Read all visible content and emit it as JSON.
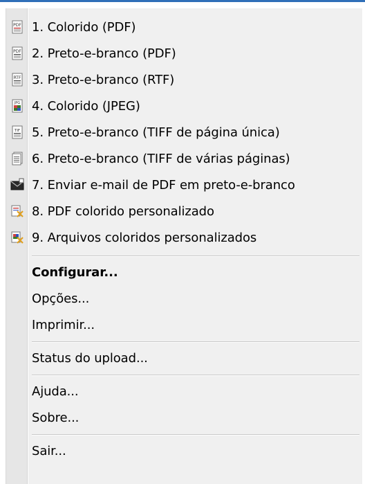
{
  "menu": {
    "formats": [
      {
        "label": "1. Colorido (PDF)",
        "icon": "pdf-icon"
      },
      {
        "label": "2. Preto-e-branco (PDF)",
        "icon": "pdf-bw-icon"
      },
      {
        "label": "3. Preto-e-branco (RTF)",
        "icon": "rtf-icon"
      },
      {
        "label": "4. Colorido (JPEG)",
        "icon": "jpeg-icon"
      },
      {
        "label": "5. Preto-e-branco (TIFF de página única)",
        "icon": "tiff-single-icon"
      },
      {
        "label": "6. Preto-e-branco (TIFF de várias páginas)",
        "icon": "tiff-multi-icon"
      },
      {
        "label": "7. Enviar e-mail de PDF em preto-e-branco",
        "icon": "email-pdf-icon"
      },
      {
        "label": "8. PDF colorido personalizado",
        "icon": "custom-pdf-icon"
      },
      {
        "label": "9. Arquivos coloridos personalizados",
        "icon": "custom-files-icon"
      }
    ],
    "configure_label": "Configurar...",
    "options_label": "Opções...",
    "print_label": "Imprimir...",
    "upload_status_label": "Status do upload...",
    "help_label": "Ajuda...",
    "about_label": "Sobre...",
    "exit_label": "Sair..."
  }
}
